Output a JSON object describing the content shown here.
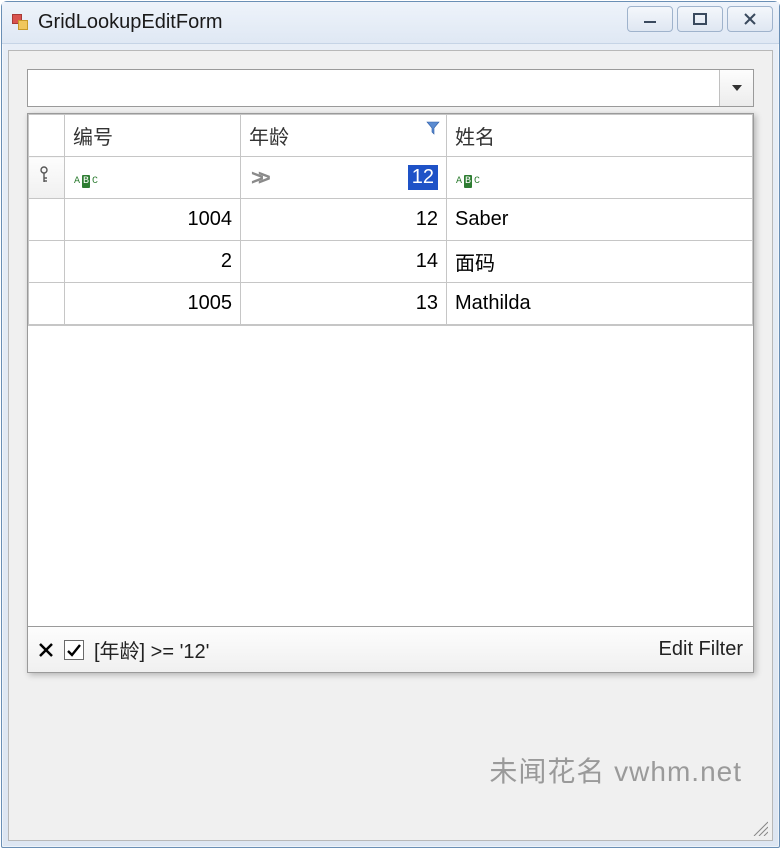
{
  "window": {
    "title": "GridLookupEditForm"
  },
  "combo": {
    "value": "",
    "placeholder": ""
  },
  "grid": {
    "columns": {
      "id": "编号",
      "age": "年龄",
      "name": "姓名"
    },
    "autofilter": {
      "age_operator": ">=",
      "age_value": "12"
    },
    "rows": [
      {
        "id": "1004",
        "age": "12",
        "name": "Saber"
      },
      {
        "id": "2",
        "age": "14",
        "name": "面码"
      },
      {
        "id": "1005",
        "age": "13",
        "name": "Mathilda"
      }
    ]
  },
  "filterPanel": {
    "expression": "[年龄] >= '12'",
    "editLabel": "Edit Filter",
    "enabled": true
  },
  "watermark": "未闻花名 vwhm.net"
}
